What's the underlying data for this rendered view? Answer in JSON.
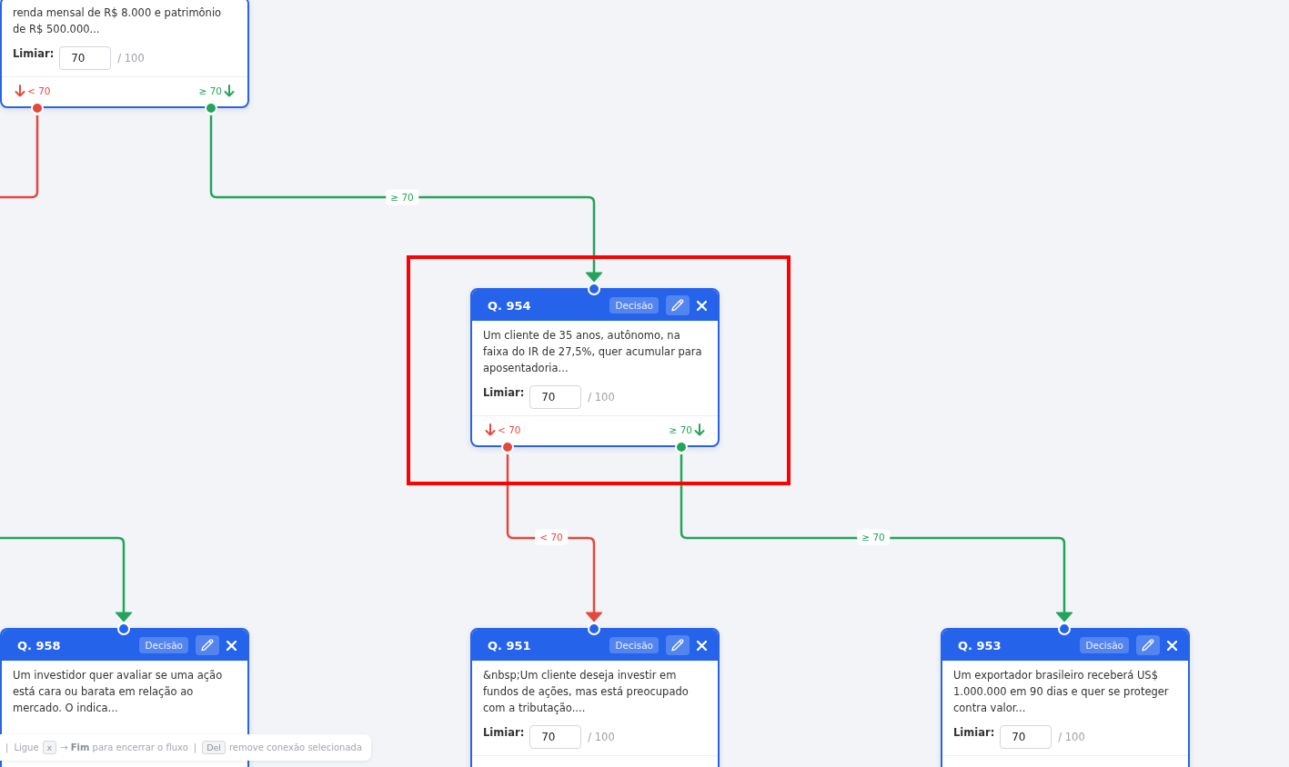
{
  "nodes": [
    {
      "description": "renda mensal de R$ 8.000 e patrimônio de R$ 500.000...",
      "threshold": {
        "label": "Limiar:",
        "value": "70",
        "max": "/ 100"
      },
      "branches": [
        {
          "kind": "fail",
          "label": "< 70"
        },
        {
          "kind": "pass",
          "label": "≥ 70"
        }
      ],
      "highlighted": false
    },
    {
      "title": "Q. 954",
      "badge": "Decisão",
      "description": "Um cliente de 35 anos, autônomo, na faixa do IR de 27,5%, quer acumular para aposentadoria...",
      "threshold": {
        "label": "Limiar:",
        "value": "70",
        "max": "/ 100"
      },
      "branches": [
        {
          "kind": "fail",
          "label": "< 70"
        },
        {
          "kind": "pass",
          "label": "≥ 70"
        }
      ],
      "highlighted": true
    },
    {
      "title": "Q. 958",
      "badge": "Decisão",
      "description": "Um investidor quer avaliar se uma ação está cara ou barata em relação ao mercado. O indica...",
      "highlighted": false
    },
    {
      "title": "Q. 951",
      "badge": "Decisão",
      "description": "&nbsp;Um cliente deseja investir em fundos de ações, mas está preocupado com a tributação....",
      "threshold": {
        "label": "Limiar:",
        "value": "70",
        "max": "/ 100"
      },
      "highlighted": false
    },
    {
      "title": "Q. 953",
      "badge": "Decisão",
      "description": "Um exportador brasileiro receberá US$ 1.000.000 em 90 dias e quer se proteger contra valor...",
      "threshold": {
        "label": "Limiar:",
        "value": "70",
        "max": "/ 100"
      },
      "highlighted": false
    }
  ],
  "edges": [
    {
      "kind": "fail"
    },
    {
      "kind": "pass",
      "label": "≥ 70"
    },
    {
      "kind": "pass"
    },
    {
      "kind": "fail",
      "label": "< 70"
    },
    {
      "kind": "pass",
      "label": "≥ 70"
    }
  ],
  "hint_bar": {
    "items": [
      {
        "kind": "separator",
        "text": "|"
      },
      {
        "kind": "text",
        "text": "Ligue"
      },
      {
        "kind": "key",
        "text": "x"
      },
      {
        "kind": "text",
        "text": "→ **Fim** para encerrar o fluxo"
      },
      {
        "kind": "separator",
        "text": "|"
      },
      {
        "kind": "key",
        "text": "Del"
      },
      {
        "kind": "text",
        "text": "remove conexão selecionada"
      }
    ]
  }
}
